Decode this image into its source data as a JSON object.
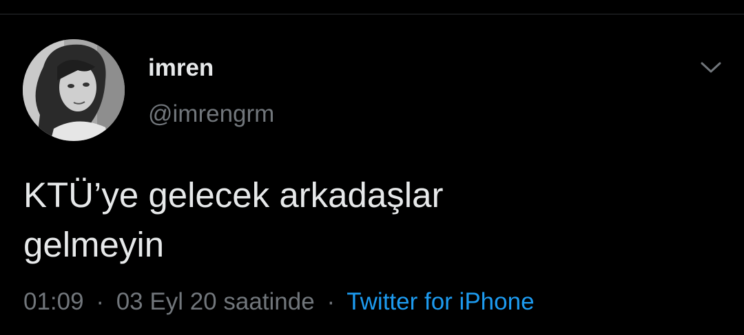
{
  "tweet": {
    "author": {
      "display_name": "imren",
      "handle": "@imrengrm",
      "avatar_icon": "profile-photo"
    },
    "more_icon": "chevron-down-icon",
    "text": "KTÜ’ye gelecek arkadaşlar\ngelmeyin",
    "meta": {
      "time": "01:09",
      "separator": "·",
      "date": "03 Eyl 20 saatinde",
      "source": "Twitter for iPhone"
    }
  },
  "colors": {
    "background": "#000000",
    "text_primary": "#e7e9ea",
    "text_secondary": "#71767b",
    "link": "#1d9bf0",
    "divider": "#2a2d30"
  }
}
